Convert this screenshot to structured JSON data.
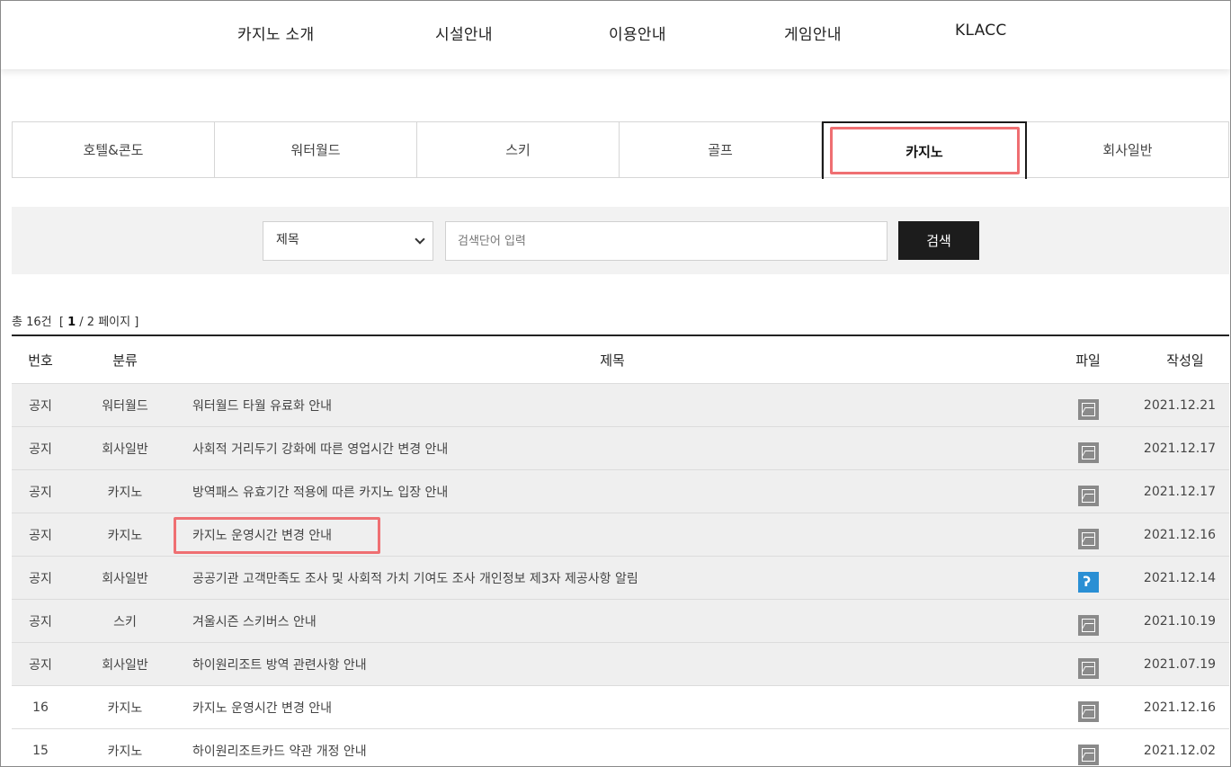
{
  "topnav": {
    "items": [
      {
        "label": "카지노 소개"
      },
      {
        "label": "시설안내"
      },
      {
        "label": "이용안내"
      },
      {
        "label": "게임안내"
      },
      {
        "label": "KLACC"
      }
    ]
  },
  "tabs": [
    {
      "label": "호텔&콘도",
      "active": false
    },
    {
      "label": "워터월드",
      "active": false
    },
    {
      "label": "스키",
      "active": false
    },
    {
      "label": "골프",
      "active": false
    },
    {
      "label": "카지노",
      "active": true
    },
    {
      "label": "회사일반",
      "active": false
    }
  ],
  "search": {
    "select_value": "제목",
    "placeholder": "검색단어 입력",
    "button_label": "검색"
  },
  "summary": {
    "prefix": "총 16건",
    "open": "[",
    "current_page": "1",
    "separator": "/ 2 페이지 ]"
  },
  "table": {
    "headers": {
      "no": "번호",
      "category": "분류",
      "title": "제목",
      "file": "파일",
      "date": "작성일"
    },
    "rows": [
      {
        "no": "공지",
        "category": "워터월드",
        "title": "워터월드 타월 유료화 안내",
        "file": "image-icon",
        "date": "2021.12.21",
        "notice": true
      },
      {
        "no": "공지",
        "category": "회사일반",
        "title": "사회적 거리두기 강화에 따른 영업시간 변경 안내",
        "file": "image-icon",
        "date": "2021.12.17",
        "notice": true
      },
      {
        "no": "공지",
        "category": "카지노",
        "title": "방역패스 유효기간 적용에 따른 카지노 입장 안내",
        "file": "image-icon",
        "date": "2021.12.17",
        "notice": true
      },
      {
        "no": "공지",
        "category": "카지노",
        "title": "카지노 운영시간 변경 안내",
        "file": "image-icon",
        "date": "2021.12.16",
        "notice": true
      },
      {
        "no": "공지",
        "category": "회사일반",
        "title": "공공기관 고객만족도 조사 및 사회적 가치 기여도 조사 개인정보 제3자 제공사항 알림",
        "file": "hwp-file-icon",
        "date": "2021.12.14",
        "notice": true
      },
      {
        "no": "공지",
        "category": "스키",
        "title": "겨울시즌 스키버스 안내",
        "file": "image-icon",
        "date": "2021.10.19",
        "notice": true
      },
      {
        "no": "공지",
        "category": "회사일반",
        "title": "하이원리조트 방역 관련사항 안내",
        "file": "image-icon",
        "date": "2021.07.19",
        "notice": true
      },
      {
        "no": "16",
        "category": "카지노",
        "title": "카지노 운영시간 변경 안내",
        "file": "image-icon",
        "date": "2021.12.16",
        "notice": false
      },
      {
        "no": "15",
        "category": "카지노",
        "title": "하이원리조트카드 약관 개정 안내",
        "file": "image-icon",
        "date": "2021.12.02",
        "notice": false
      }
    ]
  },
  "colors": {
    "highlight": "#ef6f72",
    "button": "#1c1c1c",
    "notice_bg": "#efefef",
    "hwp_icon": "#2a8fd4"
  }
}
